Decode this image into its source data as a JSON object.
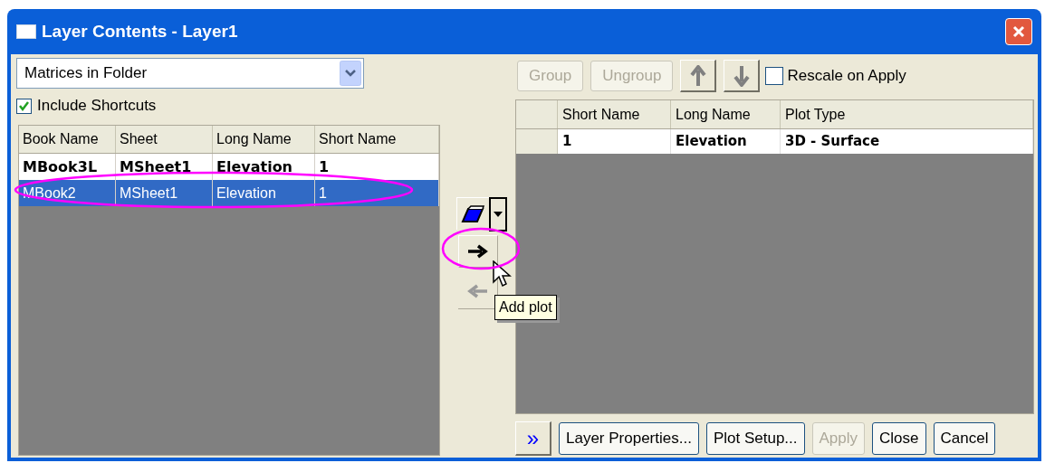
{
  "window": {
    "title": "Layer Contents - Layer1"
  },
  "source_dropdown": {
    "value": "Matrices in Folder"
  },
  "include_shortcuts": {
    "label": "Include Shortcuts",
    "checked": true
  },
  "left_table": {
    "columns": [
      "Book Name",
      "Sheet",
      "Long Name",
      "Short Name"
    ],
    "rows": [
      {
        "cells": [
          "MBook3L",
          "MSheet1",
          "Elevation",
          "1"
        ],
        "plotted": true,
        "selected": false
      },
      {
        "cells": [
          "MBook2",
          "MSheet1",
          "Elevation",
          "1"
        ],
        "plotted": false,
        "selected": true
      }
    ]
  },
  "tooltip": "Add plot",
  "right_toolbar": {
    "buttons": [
      {
        "kind": "text",
        "label": "Group",
        "disabled": true
      },
      {
        "kind": "text",
        "label": "Ungroup",
        "disabled": true
      },
      {
        "kind": "up",
        "disabled": false
      },
      {
        "kind": "down",
        "disabled": false
      }
    ],
    "rescale": {
      "label": "Rescale on Apply",
      "checked": false
    }
  },
  "right_table": {
    "columns": [
      "Short Name",
      "Long Name",
      "Plot Type"
    ],
    "rows": [
      {
        "cells": [
          "1",
          "Elevation",
          "3D - Surface"
        ],
        "plotted": true
      }
    ]
  },
  "bottom_buttons": [
    {
      "kind": "expand",
      "label": "»",
      "disabled": false
    },
    {
      "kind": "text",
      "label": "Layer Properties...",
      "disabled": false
    },
    {
      "kind": "text",
      "label": "Plot Setup...",
      "disabled": false
    },
    {
      "kind": "text",
      "label": "Apply",
      "disabled": true
    },
    {
      "kind": "text",
      "label": "Close",
      "disabled": false
    },
    {
      "kind": "text",
      "label": "Cancel",
      "disabled": false
    }
  ]
}
